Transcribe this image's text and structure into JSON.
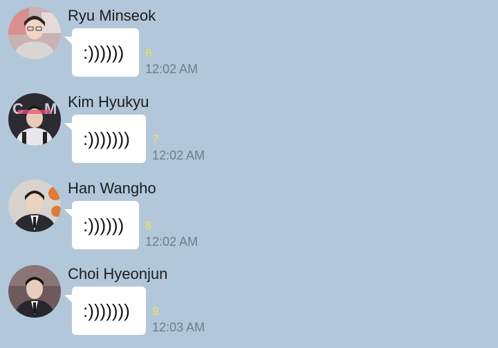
{
  "colors": {
    "background": "#b2c7da",
    "bubble": "#ffffff",
    "unread_count": "#f2e14a",
    "timestamp": "#6f7d8a"
  },
  "messages": [
    {
      "sender": "Ryu Minseok",
      "text": ":))))))",
      "unread": "6",
      "time": "12:02 AM",
      "avatar_icon": "profile-photo-icon"
    },
    {
      "sender": "Kim Hyukyu",
      "text": ":)))))))",
      "unread": "7",
      "time": "12:02 AM",
      "avatar_icon": "profile-photo-icon"
    },
    {
      "sender": "Han Wangho",
      "text": ":))))))",
      "unread": "8",
      "time": "12:02 AM",
      "avatar_icon": "profile-photo-icon"
    },
    {
      "sender": "Choi Hyeonjun",
      "text": ":)))))))",
      "unread": "9",
      "time": "12:03 AM",
      "avatar_icon": "profile-photo-icon"
    }
  ]
}
